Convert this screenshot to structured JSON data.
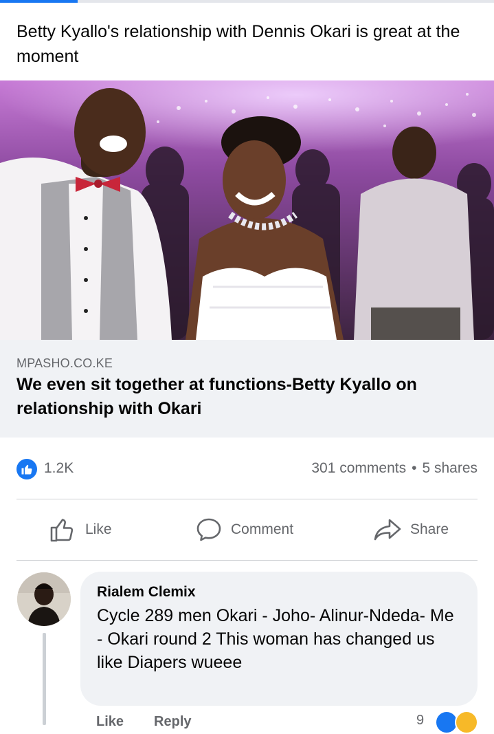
{
  "post": {
    "text": "Betty Kyallo's relationship with Dennis Okari is great at the moment"
  },
  "link": {
    "domain": "MPASHO.CO.KE",
    "title": "We even sit together at functions-Betty Kyallo on relationship with Okari"
  },
  "stats": {
    "likes": "1.2K",
    "comments": "301 comments",
    "separator": "•",
    "shares": "5 shares"
  },
  "actions": {
    "like": "Like",
    "comment": "Comment",
    "share": "Share"
  },
  "comment": {
    "author": "Rialem Clemix",
    "text": "Cycle 289 men Okari -  Joho- Alinur-Ndeda- Me - Okari round 2  This woman has changed us like Diapers wueee",
    "like_label": "Like",
    "reply_label": "Reply",
    "reaction_count": "9"
  },
  "colors": {
    "accent": "#1877f2",
    "secondary_text": "#65676b",
    "link_box_bg": "#f0f2f5"
  }
}
